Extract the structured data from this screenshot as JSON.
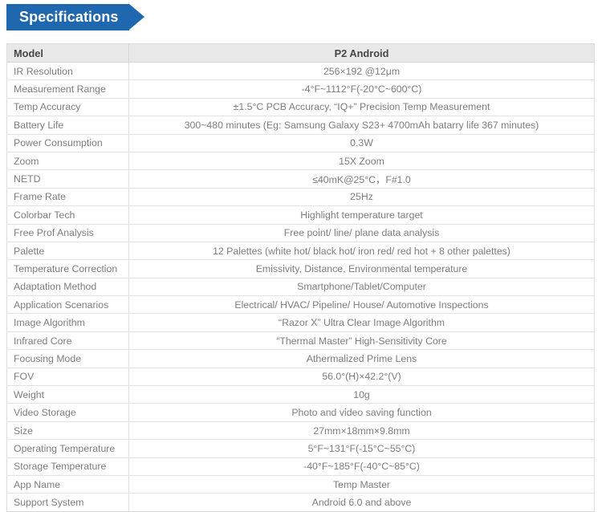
{
  "section": {
    "banner_label": "Specifications"
  },
  "colors": {
    "banner_blue": "#1f68b0",
    "header_row_bg": "#e8e8e8",
    "label_text": "#7d7d7d",
    "head_text": "#474747",
    "border": "#e3e3e3"
  },
  "table": {
    "header": {
      "label": "Model",
      "value": "P2 Android"
    },
    "rows": [
      {
        "label": "IR Resolution",
        "value": "256×192 @12μm"
      },
      {
        "label": "Measurement Range",
        "value": "-4°F~1112°F(-20°C~600°C)"
      },
      {
        "label": "Temp Accuracy",
        "value": "±1.5°C PCB Accuracy, “IQ+” Precision Temp Measurement"
      },
      {
        "label": "Battery Life",
        "value": "300~480 minutes (Eg: Samsung Galaxy S23+ 4700mAh batarry life 367 minutes)"
      },
      {
        "label": "Power Consumption",
        "value": "0.3W"
      },
      {
        "label": "Zoom",
        "value": "15X Zoom"
      },
      {
        "label": "NETD",
        "value": "≤40mK@25°C，F#1.0"
      },
      {
        "label": "Frame Rate",
        "value": "25Hz"
      },
      {
        "label": "Colorbar Tech",
        "value": "Highlight temperature target"
      },
      {
        "label": "Free Prof Analysis",
        "value": "Free point/ line/ plane data analysis"
      },
      {
        "label": "Palette",
        "value": "12 Palettes (white hot/ black hot/ iron red/ red hot + 8 other palettes)"
      },
      {
        "label": "Temperature Correction",
        "value": "Emissivity, Distance, Environmental temperature"
      },
      {
        "label": "Adaptation Method",
        "value": "Smartphone/Tablet/Computer"
      },
      {
        "label": "Application Scenarios",
        "value": "Electrical/ HVAC/ Pipeline/ House/ Automotive Inspections"
      },
      {
        "label": "Image Algorithm",
        "value": "“Razor X” Ultra Clear Image Algorithm"
      },
      {
        "label": "Infrared Core",
        "value": "“Thermal Master” High-Sensitivity Core"
      },
      {
        "label": "Focusing Mode",
        "value": "Athermalized Prime Lens"
      },
      {
        "label": "FOV",
        "value": "56.0°(H)×42.2°(V)"
      },
      {
        "label": "Weight",
        "value": "10g"
      },
      {
        "label": "Video Storage",
        "value": "Photo and video saving function"
      },
      {
        "label": "Size",
        "value": "27mm×18mm×9.8mm"
      },
      {
        "label": "Operating Temperature",
        "value": "5°F~131°F(-15°C~55°C)"
      },
      {
        "label": "Storage Temperature",
        "value": "-40°F~185°F(-40°C~85°C)"
      },
      {
        "label": "App Name",
        "value": "Temp Master"
      },
      {
        "label": "Support System",
        "value": "Android 6.0 and above"
      }
    ]
  }
}
